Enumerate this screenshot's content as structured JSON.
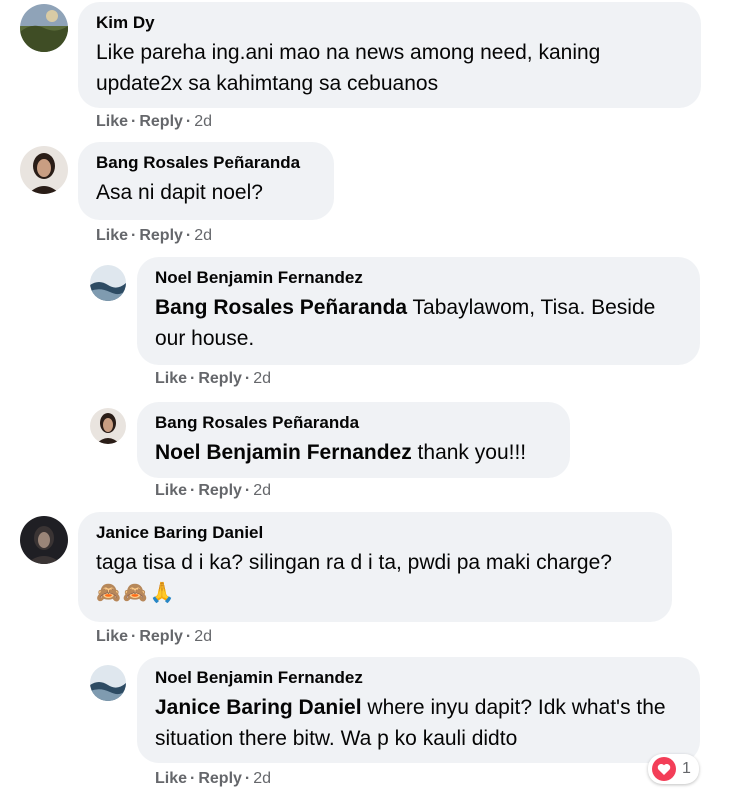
{
  "actions": {
    "like": "Like",
    "reply": "Reply",
    "separator": "·"
  },
  "comments": [
    {
      "author": "Kim Dy",
      "text": "Like pareha ing.ani mao na news among need, kaning update2x sa kahimtang sa cebuanos",
      "time": "2d",
      "avatar_icon": "landscape-avatar"
    },
    {
      "author": "Bang Rosales Peñaranda",
      "text": "Asa ni dapit noel?",
      "time": "2d",
      "avatar_icon": "person-avatar",
      "replies": [
        {
          "author": "Noel Benjamin Fernandez",
          "mention": "Bang Rosales Peñaranda",
          "text": " Tabaylawom, Tisa. Beside our house.",
          "time": "2d",
          "avatar_icon": "sea-avatar"
        },
        {
          "author": "Bang Rosales Peñaranda",
          "mention": "Noel Benjamin Fernandez",
          "text": " thank you!!!",
          "time": "2d",
          "avatar_icon": "person-avatar"
        }
      ]
    },
    {
      "author": "Janice Baring Daniel",
      "text": "taga tisa d i ka? silingan ra d i ta, pwdi pa maki charge?",
      "emojis": [
        "🙈",
        "🙈",
        "🙏"
      ],
      "time": "2d",
      "avatar_icon": "person-avatar",
      "replies": [
        {
          "author": "Noel Benjamin Fernandez",
          "mention": "Janice Baring Daniel",
          "text": " where inyu dapit? Idk what's the situation there bitw. Wa p ko kauli didto",
          "time": "2d",
          "avatar_icon": "sea-avatar",
          "reaction": {
            "icon": "heart-icon",
            "count": "1",
            "color": "#f33e58"
          }
        }
      ]
    }
  ]
}
